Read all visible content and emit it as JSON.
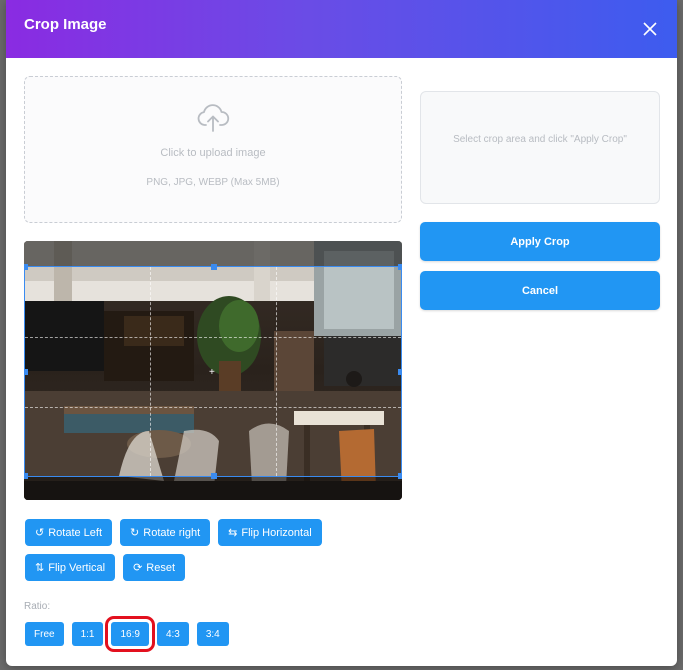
{
  "modal": {
    "title": "Crop Image"
  },
  "upload": {
    "text": "Click to upload image",
    "hint": "PNG, JPG, WEBP (Max 5MB)"
  },
  "preview": {
    "placeholder": "Select crop area and click \"Apply Crop\""
  },
  "actions": {
    "apply_label": "Apply Crop",
    "cancel_label": "Cancel"
  },
  "tools": [
    {
      "label": "Rotate Left",
      "icon": "rotate-left-icon",
      "glyph": "↺"
    },
    {
      "label": "Rotate right",
      "icon": "rotate-right-icon",
      "glyph": "↻"
    },
    {
      "label": "Flip Horizontal",
      "icon": "flip-horizontal-icon",
      "glyph": "⇆"
    },
    {
      "label": "Flip Vertical",
      "icon": "flip-vertical-icon",
      "glyph": "⇅"
    },
    {
      "label": "Reset",
      "icon": "reset-icon",
      "glyph": "⟳"
    }
  ],
  "ratio": {
    "label": "Ratio:",
    "options": [
      "Free",
      "1:1",
      "16:9",
      "4:3",
      "3:4"
    ],
    "selected": "16:9"
  },
  "colors": {
    "accent": "#2196f3",
    "header_start": "#8a2be2",
    "header_end": "#3d5cef",
    "highlight": "#e3101e"
  }
}
